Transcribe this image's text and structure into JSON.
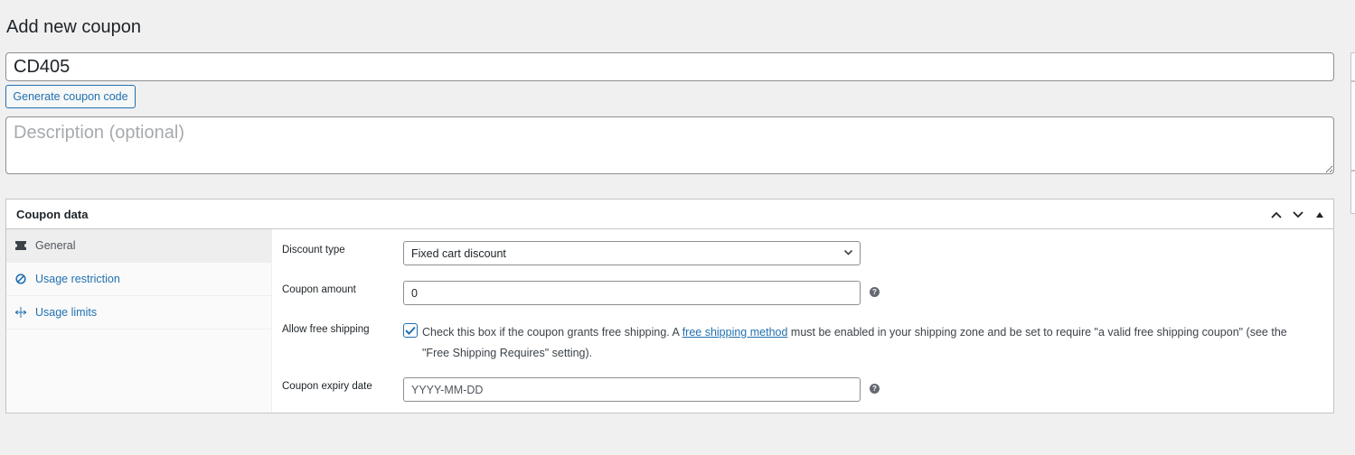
{
  "page": {
    "title": "Add new coupon"
  },
  "coupon": {
    "code_value": "CD405",
    "generate_label": "Generate coupon code",
    "description_placeholder": "Description (optional)"
  },
  "coupon_data": {
    "heading": "Coupon data",
    "tabs": [
      {
        "label": "General",
        "icon": "ticket-icon",
        "active": true
      },
      {
        "label": "Usage restriction",
        "icon": "restriction-icon",
        "active": false
      },
      {
        "label": "Usage limits",
        "icon": "limits-icon",
        "active": false
      }
    ],
    "general": {
      "discount_type_label": "Discount type",
      "discount_type_value": "Fixed cart discount",
      "coupon_amount_label": "Coupon amount",
      "coupon_amount_value": "0",
      "free_shipping_label": "Allow free shipping",
      "free_shipping_checked": true,
      "free_shipping_text_before": "Check this box if the coupon grants free shipping. A ",
      "free_shipping_link": "free shipping method",
      "free_shipping_text_after": " must be enabled in your shipping zone and be set to require \"a valid free shipping coupon\" (see the \"Free Shipping Requires\" setting).",
      "expiry_label": "Coupon expiry date",
      "expiry_placeholder": "YYYY-MM-DD"
    }
  },
  "colors": {
    "accent": "#2271b1",
    "border": "#c3c4c7",
    "background": "#f0f0f1"
  }
}
